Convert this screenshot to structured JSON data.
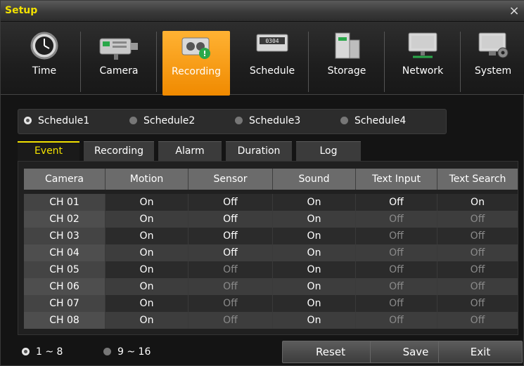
{
  "window": {
    "title": "Setup",
    "close_label": "×"
  },
  "toolbar": {
    "items": [
      {
        "label": "Time",
        "icon": "clock-icon"
      },
      {
        "label": "Camera",
        "icon": "camera-icon"
      },
      {
        "label": "Recording",
        "icon": "recorder-icon",
        "active": true
      },
      {
        "label": "Schedule",
        "icon": "calendar-icon"
      },
      {
        "label": "Storage",
        "icon": "storage-icon"
      },
      {
        "label": "Network",
        "icon": "network-icon"
      },
      {
        "label": "System",
        "icon": "system-icon"
      }
    ],
    "active_color": "#f59a00"
  },
  "schedules": {
    "items": [
      "Schedule1",
      "Schedule2",
      "Schedule3",
      "Schedule4"
    ],
    "selected": "Schedule1"
  },
  "tabs": {
    "items": [
      "Event",
      "Recording",
      "Alarm",
      "Duration",
      "Log"
    ],
    "selected": "Event",
    "accent": "#f2e100"
  },
  "table": {
    "headers": [
      "Camera",
      "Motion",
      "Sensor",
      "Sound",
      "Text Input",
      "Text Search"
    ],
    "rows": [
      [
        "CH 01",
        "On",
        "Off",
        "On",
        "Off",
        "On"
      ],
      [
        "CH 02",
        "On",
        "Off",
        "On",
        "Off",
        "Off"
      ],
      [
        "CH 03",
        "On",
        "Off",
        "On",
        "Off",
        "Off"
      ],
      [
        "CH 04",
        "On",
        "Off",
        "On",
        "Off",
        "Off"
      ],
      [
        "CH 05",
        "On",
        "Off",
        "On",
        "Off",
        "Off"
      ],
      [
        "CH 06",
        "On",
        "Off",
        "On",
        "Off",
        "Off"
      ],
      [
        "CH 07",
        "On",
        "Off",
        "On",
        "Off",
        "Off"
      ],
      [
        "CH 08",
        "On",
        "Off",
        "On",
        "Off",
        "Off"
      ]
    ],
    "dimmed": [
      [
        false,
        false,
        false,
        false,
        false,
        false
      ],
      [
        false,
        false,
        false,
        false,
        true,
        true
      ],
      [
        false,
        false,
        false,
        false,
        true,
        true
      ],
      [
        false,
        false,
        false,
        false,
        true,
        true
      ],
      [
        false,
        false,
        true,
        false,
        true,
        true
      ],
      [
        false,
        false,
        true,
        false,
        true,
        true
      ],
      [
        false,
        false,
        true,
        false,
        true,
        true
      ],
      [
        false,
        false,
        true,
        false,
        true,
        true
      ]
    ]
  },
  "channel_range": {
    "items": [
      "1 ~ 8",
      "9 ~ 16"
    ],
    "selected": "1 ~ 8"
  },
  "buttons": {
    "reset": "Reset",
    "save": "Save",
    "exit": "Exit"
  }
}
